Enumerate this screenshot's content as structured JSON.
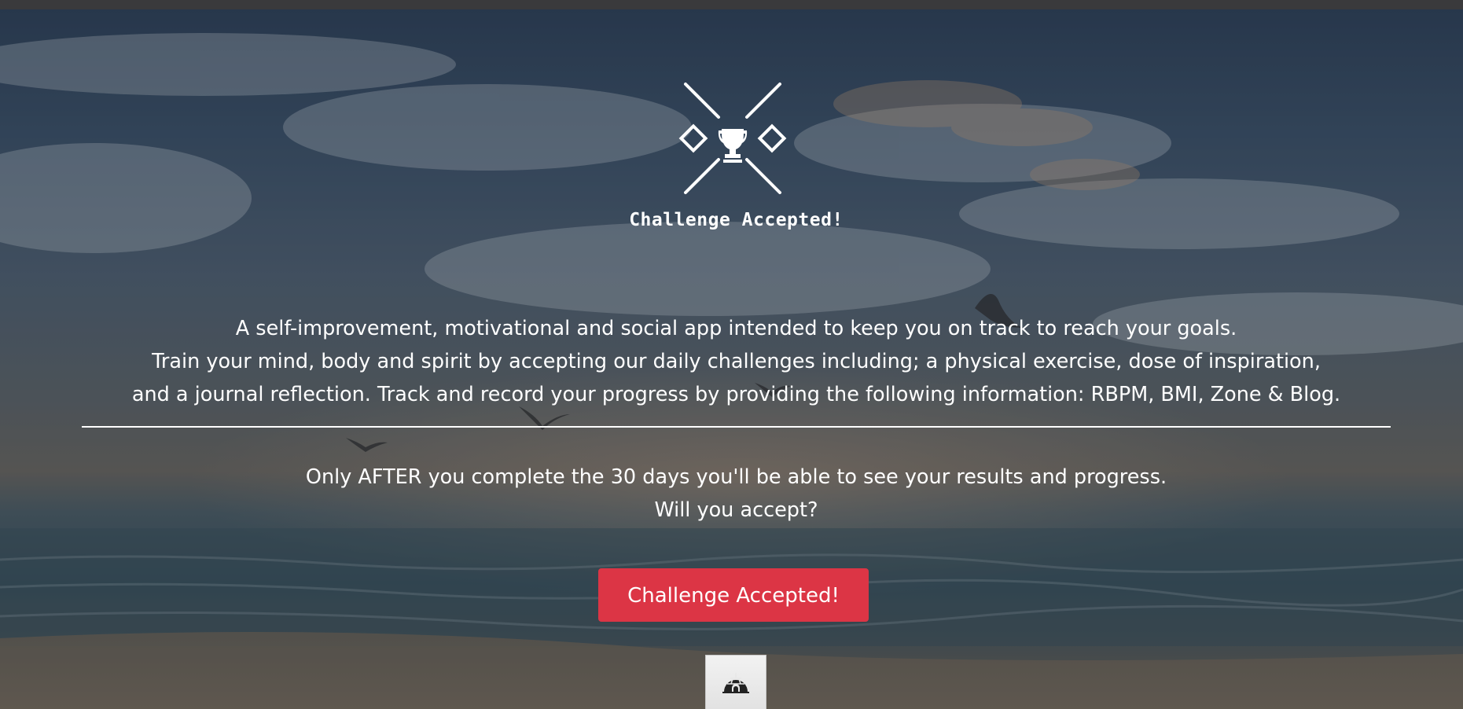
{
  "topbar": {
    "color": "#3a3a3c"
  },
  "header": {
    "logo_icon": "trophy-crossed-swords-icon",
    "brand": "Challenge Accepted!"
  },
  "intro": {
    "line1": "A self-improvement, motivational and social app intended to keep you on track to reach your goals.",
    "line2": "Train your mind, body and spirit by accepting our daily challenges including; a physical exercise, dose of inspiration,",
    "line3": "and a journal reflection. Track and record your progress by providing the following information: RBPM, BMI, Zone & Blog."
  },
  "notice": {
    "line1": "Only AFTER you complete the 30 days you'll be able to see your results and progress.",
    "line2": "Will you accept?"
  },
  "cta": {
    "label": "Challenge Accepted!",
    "color": "#dc3545"
  },
  "footer": {
    "icon": "igloo-icon"
  }
}
